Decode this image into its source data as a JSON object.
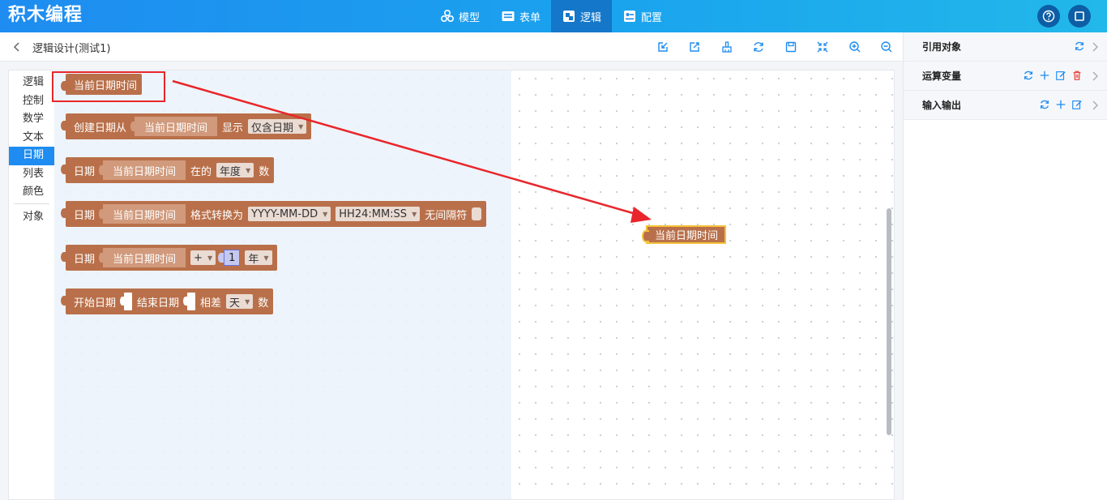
{
  "app": {
    "title": "积木编程"
  },
  "nav": {
    "items": [
      {
        "label": "模型",
        "icon": "model-cubes-icon"
      },
      {
        "label": "表单",
        "icon": "form-icon"
      },
      {
        "label": "逻辑",
        "icon": "logic-blocks-icon",
        "active": true
      },
      {
        "label": "配置",
        "icon": "config-icon"
      }
    ]
  },
  "topRight": {
    "icons": [
      "help-icon",
      "fullscreen-icon"
    ]
  },
  "header": {
    "title": "逻辑设计(测试1)",
    "toolbar": [
      "import-icon",
      "export-icon",
      "clear-icon",
      "refresh-icon",
      "save-icon",
      "fit-icon",
      "zoom-in-icon",
      "zoom-out-icon"
    ]
  },
  "categories": {
    "items": [
      "逻辑",
      "控制",
      "数学",
      "文本",
      "日期",
      "列表",
      "颜色"
    ],
    "after_separator": [
      "对象"
    ],
    "active": "日期"
  },
  "blocks": {
    "b1": {
      "label": "当前日期时间"
    },
    "b2": {
      "prefix": "创建日期从",
      "inner": "当前日期时间",
      "mid": "显示",
      "dropdown": "仅含日期"
    },
    "b3": {
      "prefix": "日期",
      "inner": "当前日期时间",
      "mid": "在的",
      "dropdown": "年度",
      "suffix": "数"
    },
    "b4": {
      "prefix": "日期",
      "inner": "当前日期时间",
      "mid": "格式转换为",
      "dropdown1": "YYYY-MM-DD",
      "dropdown2": "HH24:MM:SS",
      "suffix": "无间隔符"
    },
    "b5": {
      "prefix": "日期",
      "inner": "当前日期时间",
      "op": "+",
      "number": "1",
      "unit": "年"
    },
    "b6": {
      "prefix": "开始日期",
      "mid": "结束日期",
      "mid2": "相差",
      "dropdown": "天",
      "suffix": "数"
    }
  },
  "canvas": {
    "block_label": "当前日期时间"
  },
  "colors": {
    "accent": "#1e8cf0",
    "block": "#b9704a",
    "highlight": "#e8262b",
    "selection": "#f4c23b"
  },
  "rightPanel": {
    "rows": [
      {
        "label": "引用对象",
        "actions": [
          "refresh-icon"
        ]
      },
      {
        "label": "运算变量",
        "actions": [
          "refresh-icon",
          "add-icon",
          "edit-icon",
          "delete-icon"
        ]
      },
      {
        "label": "输入输出",
        "actions": [
          "refresh-icon",
          "add-icon",
          "edit-icon"
        ]
      }
    ]
  }
}
